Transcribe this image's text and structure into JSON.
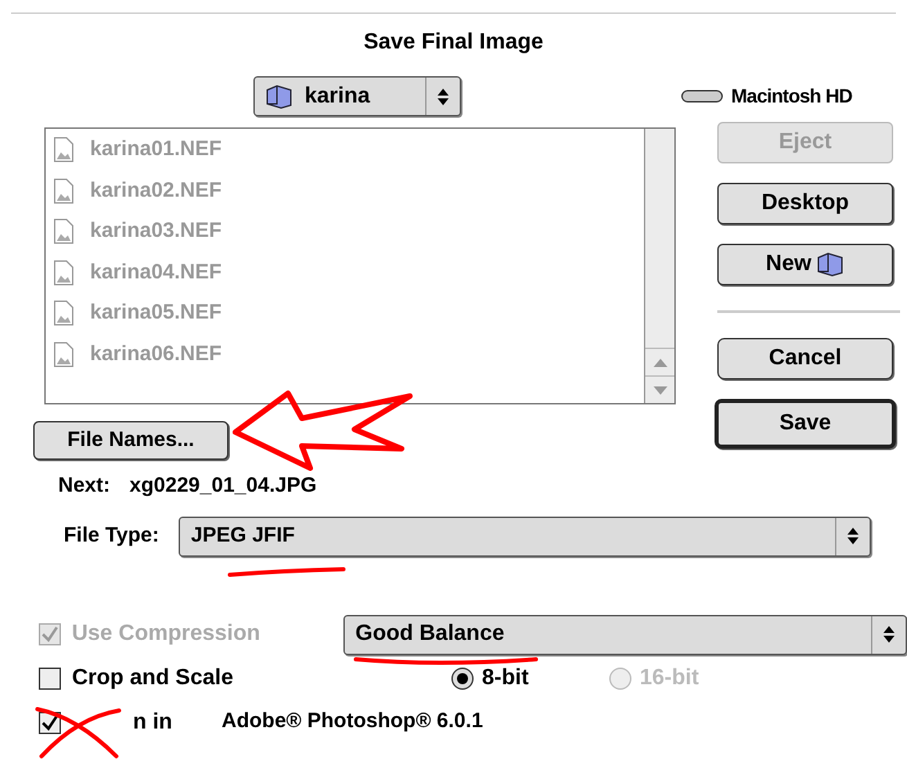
{
  "title": "Save Final Image",
  "folder_popup": {
    "label": "karina"
  },
  "volume": {
    "label": "Macintosh HD"
  },
  "files": [
    {
      "name": "karina01.NEF"
    },
    {
      "name": "karina02.NEF"
    },
    {
      "name": "karina03.NEF"
    },
    {
      "name": "karina04.NEF"
    },
    {
      "name": "karina05.NEF"
    },
    {
      "name": "karina06.NEF"
    }
  ],
  "top_buttons": [
    {
      "label": "Eject",
      "disabled": true,
      "kind": "plain"
    },
    {
      "label": "Desktop",
      "disabled": false,
      "kind": "plain"
    },
    {
      "label": "New",
      "disabled": false,
      "kind": "folder"
    }
  ],
  "bottom_buttons": [
    {
      "label": "Cancel",
      "default": false
    },
    {
      "label": "Save",
      "default": true
    }
  ],
  "file_names_button": {
    "label": "File Names..."
  },
  "next": {
    "label": "Next:",
    "value": "xg0229_01_04.JPG"
  },
  "file_type": {
    "label": "File Type:",
    "value": "JPEG JFIF"
  },
  "use_compression": {
    "label": "Use Compression",
    "checked": true,
    "disabled": true,
    "value": "Good Balance"
  },
  "crop_and_scale": {
    "label": "Crop and Scale",
    "checked": false
  },
  "bit_depth": [
    {
      "label": "8-bit",
      "selected": true,
      "disabled": false
    },
    {
      "label": "16-bit",
      "selected": false,
      "disabled": true
    }
  ],
  "open_in": {
    "label": "n in",
    "checked": true,
    "app": "Adobe® Photoshop® 6.0.1"
  }
}
